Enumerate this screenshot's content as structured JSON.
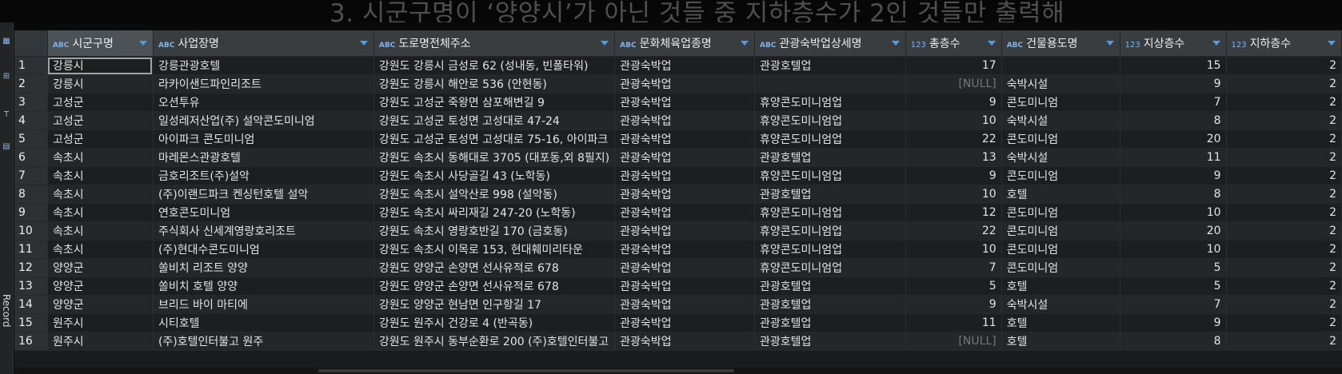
{
  "slide_title": "3.  시군구명이 ‘양양시’가 아닌 것들 중 지하층수가 2인 것들만 출력해",
  "sidebar": {
    "vertical_label": "Record"
  },
  "columns": [
    {
      "type": "ABC",
      "name": "시군구명"
    },
    {
      "type": "ABC",
      "name": "사업장명"
    },
    {
      "type": "ABC",
      "name": "도로명전체주소"
    },
    {
      "type": "ABC",
      "name": "문화체육업종명"
    },
    {
      "type": "ABC",
      "name": "관광숙박업상세명"
    },
    {
      "type": "123",
      "name": "총층수"
    },
    {
      "type": "ABC",
      "name": "건물용도명"
    },
    {
      "type": "123",
      "name": "지상층수"
    },
    {
      "type": "123",
      "name": "지하층수"
    }
  ],
  "rows": [
    [
      "1",
      "강릉시",
      "강릉관광호텔",
      "강원도 강릉시 금성로 62 (성내동, 빈폴타워)",
      "관광숙박업",
      "관광호텔업",
      "17",
      "",
      "15",
      "2"
    ],
    [
      "2",
      "강릉시",
      "라카이샌드파인리조트",
      "강원도 강릉시 해안로 536 (안현동)",
      "관광숙박업",
      "",
      "[NULL]",
      "숙박시설",
      "9",
      "2"
    ],
    [
      "3",
      "고성군",
      "오션투유",
      "강원도 고성군 죽왕면 삼포해변길 9",
      "관광숙박업",
      "휴양콘도미니엄업",
      "9",
      "콘도미니엄",
      "7",
      "2"
    ],
    [
      "4",
      "고성군",
      "일성레저산업(주) 설악콘도미니엄",
      "강원도 고성군 토성면 고성대로 47-24",
      "관광숙박업",
      "휴양콘도미니엄업",
      "10",
      "숙박시설",
      "8",
      "2"
    ],
    [
      "5",
      "고성군",
      "아이파크 콘도미니엄",
      "강원도 고성군 토성면 고성대로 75-16, 아이파크",
      "관광숙박업",
      "휴양콘도미니엄업",
      "22",
      "콘도미니엄",
      "20",
      "2"
    ],
    [
      "6",
      "속초시",
      "마레몬스관광호텔",
      "강원도 속초시 동해대로 3705 (대포동,외 8필지)",
      "관광숙박업",
      "관광호텔업",
      "13",
      "숙박시설",
      "11",
      "2"
    ],
    [
      "7",
      "속초시",
      "금호리조트(주)설악",
      "강원도 속초시 사당골길 43 (노학동)",
      "관광숙박업",
      "휴양콘도미니엄업",
      "9",
      "콘도미니엄",
      "9",
      "2"
    ],
    [
      "8",
      "속초시",
      "(주)이랜드파크 켄싱턴호텔 설악",
      "강원도 속초시 설악산로 998 (설악동)",
      "관광숙박업",
      "관광호텔업",
      "10",
      "호텔",
      "8",
      "2"
    ],
    [
      "9",
      "속초시",
      "연호콘도미니엄",
      "강원도 속초시 싸리재길 247-20 (노학동)",
      "관광숙박업",
      "휴양콘도미니엄업",
      "12",
      "콘도미니엄",
      "10",
      "2"
    ],
    [
      "10",
      "속초시",
      "주식회사 신세계영랑호리조트",
      "강원도 속초시 영랑호반길 170 (금호동)",
      "관광숙박업",
      "휴양콘도미니엄업",
      "22",
      "콘도미니엄",
      "20",
      "2"
    ],
    [
      "11",
      "속초시",
      "(주)현대수콘도미니엄",
      "강원도 속초시 이목로 153, 현대훼미리타운",
      "관광숙박업",
      "휴양콘도미니엄업",
      "10",
      "콘도미니엄",
      "10",
      "2"
    ],
    [
      "12",
      "양양군",
      "쏠비치 리조트 양양",
      "강원도 양양군 손양면 선사유적로 678",
      "관광숙박업",
      "휴양콘도미니엄업",
      "7",
      "콘도미니엄",
      "5",
      "2"
    ],
    [
      "13",
      "양양군",
      "쏠비치 호텔 양양",
      "강원도 양양군 손양면 선사유적로 678",
      "관광숙박업",
      "관광호텔업",
      "5",
      "호텔",
      "5",
      "2"
    ],
    [
      "14",
      "양양군",
      "브리드 바이 마티에",
      "강원도 양양군 현남면 인구항길 17",
      "관광숙박업",
      "관광호텔업",
      "9",
      "숙박시설",
      "7",
      "2"
    ],
    [
      "15",
      "원주시",
      "시티호텔",
      "강원도 원주시 건강로 4 (반곡동)",
      "관광숙박업",
      "관광호텔업",
      "11",
      "호텔",
      "9",
      "2"
    ],
    [
      "16",
      "원주시",
      "(주)호텔인터불고 원주",
      "강원도 원주시 동부순환로 200 (주)호텔인터불고",
      "관광숙박업",
      "관광호텔업",
      "[NULL]",
      "호텔",
      "8",
      "2"
    ]
  ],
  "selected_cell": {
    "row": 1,
    "column": "시군구명"
  }
}
